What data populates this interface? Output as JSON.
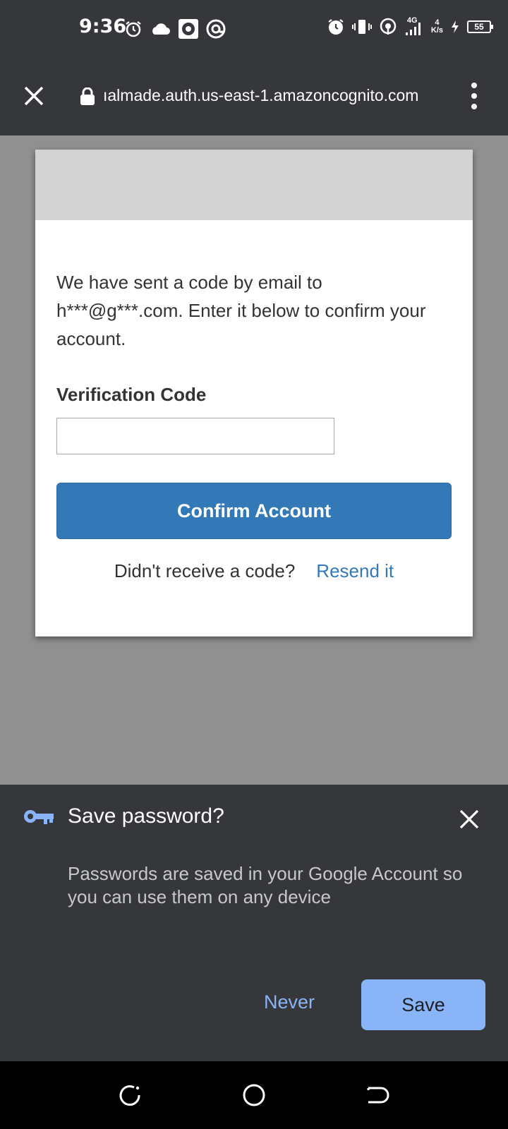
{
  "status_bar": {
    "time": "9:36",
    "network_type": "4G",
    "speed_value": "4",
    "speed_unit": "K/s",
    "battery": "55"
  },
  "browser": {
    "url": "ıalmade.auth.us-east-1.amazoncognito.com"
  },
  "page": {
    "message": "We have sent a code by email to h***@g***.com. Enter it below to confirm your account.",
    "code_label": "Verification Code",
    "code_value": "",
    "confirm_label": "Confirm Account",
    "resend_prompt": "Didn't receive a code?",
    "resend_link": "Resend it"
  },
  "save_password": {
    "title": "Save password?",
    "description": "Passwords are saved in your Google Account so you can use them on any device",
    "never_label": "Never",
    "save_label": "Save"
  },
  "colors": {
    "accent_blue": "#3379b8",
    "sheet_button": "#8ab4f8",
    "dark_bar": "#36373b"
  }
}
